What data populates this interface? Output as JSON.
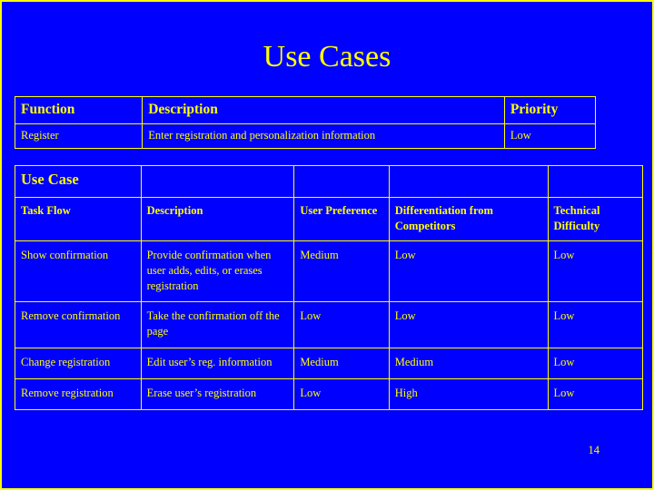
{
  "slide": {
    "title": "Use Cases",
    "page_number": "14"
  },
  "top_table": {
    "headers": [
      "Function",
      "Description",
      "Priority"
    ],
    "rows": [
      [
        "Register",
        "Enter registration and personalization information",
        "Low"
      ]
    ]
  },
  "main_table": {
    "band_label": "Use Case",
    "headers": [
      "Task Flow",
      "Description",
      "User Preference",
      "Differentiation from Competitors",
      "Technical Difficulty"
    ],
    "rows": [
      [
        "Show confirmation",
        "Provide confirmation when user adds, edits, or erases registration",
        "Medium",
        "Low",
        "Low"
      ],
      [
        "Remove confirmation",
        "Take the confirmation off the page",
        "Low",
        "Low",
        "Low"
      ],
      [
        "Change registration",
        "Edit user’s reg. information",
        "Medium",
        "Medium",
        "Low"
      ],
      [
        "Remove registration",
        "Erase user’s registration",
        "Low",
        "High",
        "Low"
      ]
    ]
  }
}
